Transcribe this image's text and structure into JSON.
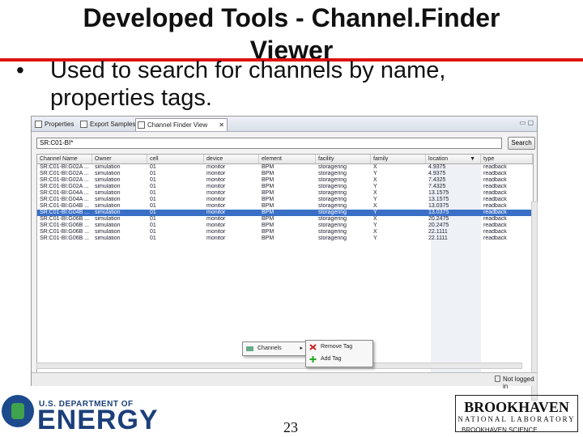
{
  "slide": {
    "title_line1": "Developed Tools - Channel.Finder",
    "title_line2": "Viewer",
    "bullet_line1": "Used to search for channels by name,",
    "bullet_line2": "properties tags.",
    "page_number": "23"
  },
  "window": {
    "tabs": [
      {
        "label": "Properties",
        "icon": "properties-icon"
      },
      {
        "label": "Export Samples",
        "icon": "export-icon"
      },
      {
        "label": "Channel Finder View",
        "icon": "search-view-icon"
      }
    ],
    "search": {
      "value": "SR:C01-BI*",
      "button_label": "Search"
    },
    "columns": [
      "Channel Name",
      "Owner",
      "cell",
      "device",
      "element",
      "facility",
      "family",
      "location",
      "type"
    ],
    "sort_indicator": "▼",
    "rows": [
      [
        "SR:C01-BI:G02A ...",
        "simulation",
        "01",
        "monitor",
        "BPM",
        "storagering",
        "X",
        "4.9375",
        "readback"
      ],
      [
        "SR:C01-BI:G02A ...",
        "simulation",
        "01",
        "monitor",
        "BPM",
        "storagering",
        "Y",
        "4.9375",
        "readback"
      ],
      [
        "SR:C01-BI:G02A ...",
        "simulation",
        "01",
        "monitor",
        "BPM",
        "storagering",
        "X",
        "7.4325",
        "readback"
      ],
      [
        "SR:C01-BI:G02A ...",
        "simulation",
        "01",
        "monitor",
        "BPM",
        "storagering",
        "Y",
        "7.4325",
        "readback"
      ],
      [
        "SR:C01-BI:G04A ...",
        "simulation",
        "01",
        "monitor",
        "BPM",
        "storagering",
        "X",
        "13.1575",
        "readback"
      ],
      [
        "SR:C01-BI:G04A ...",
        "simulation",
        "01",
        "monitor",
        "BPM",
        "storagering",
        "Y",
        "13.1575",
        "readback"
      ],
      [
        "SR:C01-BI:G04B ...",
        "simulation",
        "01",
        "monitor",
        "BPM",
        "storagering",
        "X",
        "13.0375",
        "readback"
      ],
      [
        "SR:C01-BI:G04B ...",
        "simulation",
        "01",
        "monitor",
        "BPM",
        "storagering",
        "Y",
        "13.0375",
        "readback"
      ],
      [
        "SR:C01-BI:G06B ...",
        "simulation",
        "01",
        "monitor",
        "BPM",
        "storagering",
        "X",
        "20.2475",
        "readback"
      ],
      [
        "SR:C01-BI:G06B ...",
        "simulation",
        "01",
        "monitor",
        "BPM",
        "storagering",
        "Y",
        "20.2475",
        "readback"
      ],
      [
        "SR:C01-BI:G06B ...",
        "simulation",
        "01",
        "monitor",
        "BPM",
        "storagering",
        "X",
        "22.1111",
        "readback"
      ],
      [
        "SR:C01-BI:G06B ...",
        "simulation",
        "01",
        "monitor",
        "BPM",
        "storagering",
        "Y",
        "22.1111",
        "readback"
      ]
    ],
    "selected_row_index": 7,
    "context_menu": {
      "item": "Channels",
      "submenu": [
        "Remove Tag",
        "Add Tag"
      ]
    },
    "status": "Not logged in"
  },
  "footer": {
    "doe_small": "U.S. DEPARTMENT OF",
    "doe_big": "ENERGY",
    "bnl_name": "BROOKHAVEN",
    "bnl_lab": "NATIONAL LABORATORY",
    "bnl_science": "BROOKHAVEN SCIENCE"
  },
  "colors": {
    "accent_rule": "#dd1111",
    "selection": "#3a6fc6",
    "doe_blue": "#1c3f7a"
  }
}
